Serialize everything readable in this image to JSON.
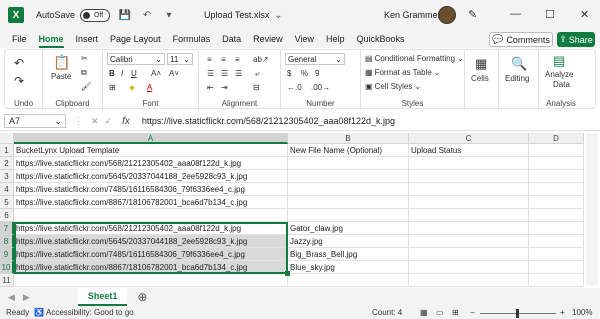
{
  "titlebar": {
    "app_icon": "X",
    "autosave_label": "AutoSave",
    "autosave_state": "Off",
    "doc_title": "Upload Test.xlsx",
    "user_name": "Ken Grammer"
  },
  "tabs": [
    "File",
    "Home",
    "Insert",
    "Page Layout",
    "Formulas",
    "Data",
    "Review",
    "View",
    "Help",
    "QuickBooks"
  ],
  "header_buttons": {
    "comments": "Comments",
    "share": "Share"
  },
  "ribbon": {
    "undo_group": "Undo",
    "clipboard": {
      "paste": "Paste",
      "label": "Clipboard"
    },
    "font": {
      "name": "Calibri",
      "size": "11",
      "label": "Font"
    },
    "alignment": {
      "label": "Alignment"
    },
    "number": {
      "format": "General",
      "label": "Number",
      "percent": "%",
      "comma": "9"
    },
    "styles": {
      "conditional": "Conditional Formatting",
      "table": "Format as Table",
      "cell": "Cell Styles",
      "label": "Styles"
    },
    "cells": {
      "label": "Cells"
    },
    "editing": {
      "label": "Editing"
    },
    "analysis": {
      "analyze": "Analyze",
      "data": "Data",
      "label": "Analysis"
    }
  },
  "formula": {
    "namebox": "A7",
    "fx": "fx",
    "value": "https://live.staticflickr.com/568/21212305402_aaa08f122d_k.jpg"
  },
  "columns": [
    "A",
    "B",
    "C",
    "D"
  ],
  "rows": [
    {
      "n": "1",
      "a": "BucketLynx Upload Template",
      "b": "New File Name (Optional)",
      "c": "Upload Status"
    },
    {
      "n": "2",
      "a": "https://live.staticflickr.com/568/21212305402_aaa08f122d_k.jpg",
      "b": "",
      "c": ""
    },
    {
      "n": "3",
      "a": "https://live.staticflickr.com/5645/20337044188_2ee5928c93_k.jpg",
      "b": "",
      "c": ""
    },
    {
      "n": "4",
      "a": "https://live.staticflickr.com/7485/16116584306_79f6336ee4_c.jpg",
      "b": "",
      "c": ""
    },
    {
      "n": "5",
      "a": "https://live.staticflickr.com/8867/18106782001_bca6d7b134_c.jpg",
      "b": "",
      "c": ""
    },
    {
      "n": "6",
      "a": "",
      "b": "",
      "c": ""
    },
    {
      "n": "7",
      "a": "https://live.staticflickr.com/568/21212305402_aaa08f122d_k.jpg",
      "b": "Gator_claw.jpg",
      "c": ""
    },
    {
      "n": "8",
      "a": "https://live.staticflickr.com/5645/20337044188_2ee5928c93_k.jpg",
      "b": "Jazzy.jpg",
      "c": ""
    },
    {
      "n": "9",
      "a": "https://live.staticflickr.com/7485/16116584306_79f6336ee4_c.jpg",
      "b": "Big_Brass_Bell.jpg",
      "c": ""
    },
    {
      "n": "10",
      "a": "https://live.staticflickr.com/8867/18106782001_bca6d7b134_c.jpg",
      "b": "Blue_sky.jpg",
      "c": ""
    },
    {
      "n": "11",
      "a": "",
      "b": "",
      "c": ""
    }
  ],
  "sheet": {
    "name": "Sheet1"
  },
  "status": {
    "ready": "Ready",
    "accessibility": "Accessibility: Good to go",
    "count": "Count: 4",
    "zoom": "100%"
  },
  "colors": {
    "accent": "#107c41",
    "selection_fill": "#d9d9d9"
  }
}
